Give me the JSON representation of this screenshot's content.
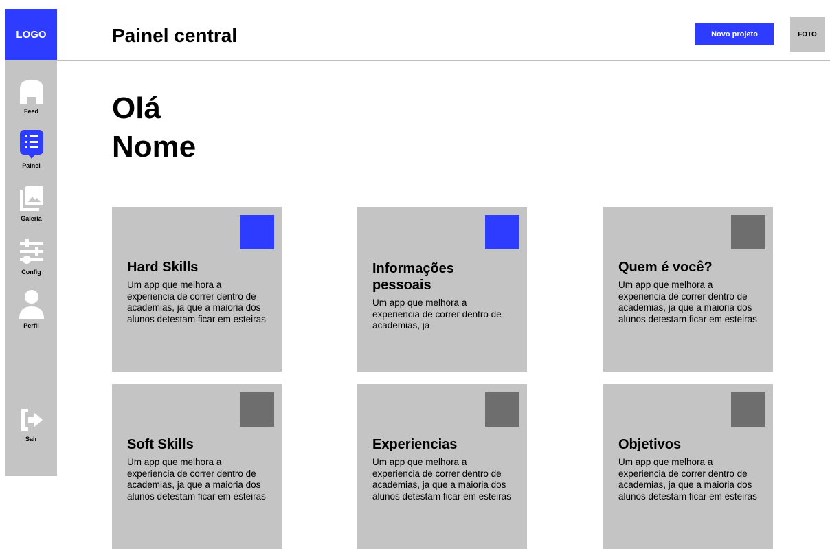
{
  "logo": "LOGO",
  "header": {
    "title": "Painel central",
    "new_project": "Novo projeto",
    "photo": "FOTO"
  },
  "sidebar": {
    "items": [
      {
        "label": "Feed",
        "icon": "home-icon"
      },
      {
        "label": "Painel",
        "icon": "list-icon",
        "active": true
      },
      {
        "label": "Galeria",
        "icon": "gallery-icon"
      },
      {
        "label": "Config",
        "icon": "sliders-icon"
      },
      {
        "label": "Perfil",
        "icon": "user-icon"
      }
    ],
    "logout": {
      "label": "Sair",
      "icon": "logout-icon"
    }
  },
  "greeting": {
    "line1": "Olá",
    "line2": "Nome"
  },
  "colors": {
    "accent": "#2e3cff",
    "panel": "#c4c4c4",
    "square_inactive": "#6e6e6e"
  },
  "cards": [
    {
      "title": "Hard Skills",
      "desc": "Um app que melhora a experiencia de correr dentro de academias, ja que a maioria dos alunos detestam ficar em esteiras",
      "square": "#2e3cff"
    },
    {
      "title": "Informações pessoais",
      "desc": "Um app que melhora a experiencia de correr dentro de academias, ja",
      "square": "#2e3cff"
    },
    {
      "title": "Quem é você?",
      "desc": "Um app que melhora a experiencia de correr dentro de academias, ja que a maioria dos alunos detestam ficar em esteiras",
      "square": "#6e6e6e"
    },
    {
      "title": "Soft Skills",
      "desc": "Um app que melhora a experiencia de correr dentro de academias, ja que a maioria dos alunos detestam ficar em esteiras",
      "square": "#6e6e6e"
    },
    {
      "title": "Experiencias",
      "desc": "Um app que melhora a experiencia de correr dentro de academias, ja que a maioria dos alunos detestam ficar em esteiras",
      "square": "#6e6e6e"
    },
    {
      "title": "Objetivos",
      "desc": "Um app que melhora a experiencia de correr dentro de academias, ja que a maioria dos alunos detestam ficar em esteiras",
      "square": "#6e6e6e"
    }
  ]
}
